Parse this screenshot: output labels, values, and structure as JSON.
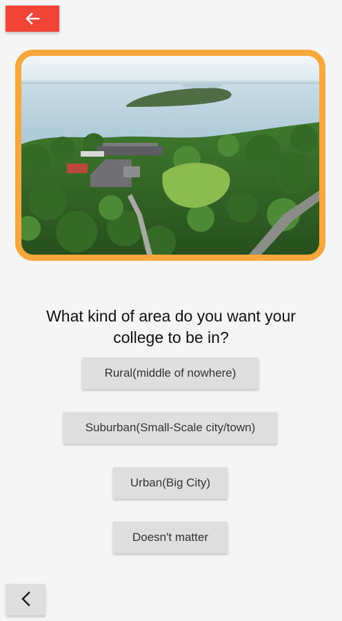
{
  "header": {
    "back_icon": "arrow-left-icon",
    "accent_color": "#f14336"
  },
  "image": {
    "icon": "campus-aerial-photo",
    "frame_color": "#f9a63a"
  },
  "question": {
    "text": "What kind of area do you want your college to be in?"
  },
  "answers": [
    {
      "label": "Rural(middle of nowhere)"
    },
    {
      "label": "Suburban(Small-Scale city/town)"
    },
    {
      "label": "Urban(Big City)"
    },
    {
      "label": "Doesn't matter"
    }
  ],
  "footer": {
    "prev_icon": "chevron-left-icon"
  }
}
